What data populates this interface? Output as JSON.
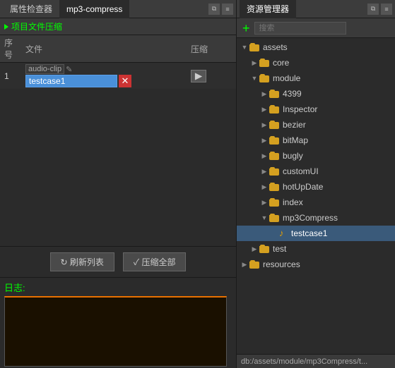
{
  "left_panel": {
    "tabs": [
      {
        "label": "属性检查器",
        "active": false
      },
      {
        "label": "mp3-compress",
        "active": true
      }
    ],
    "section_title": "项目文件压缩",
    "table": {
      "col_num": "序号",
      "col_file": "文件",
      "col_compress": "压缩",
      "rows": [
        {
          "num": "1",
          "file_label": "audio-clip",
          "file_value": "testcase1",
          "has_delete": true,
          "has_play": true
        }
      ]
    },
    "buttons": {
      "refresh": "↻ 刷新列表",
      "compress": "✓ 压缩全部"
    },
    "log": {
      "label": "日志:"
    }
  },
  "right_panel": {
    "tab_label": "资源管理器",
    "add_button": "+",
    "search_placeholder": "搜索",
    "tree": [
      {
        "level": 0,
        "label": "assets",
        "type": "folder",
        "expanded": true
      },
      {
        "level": 1,
        "label": "core",
        "type": "folder",
        "expanded": false
      },
      {
        "level": 1,
        "label": "module",
        "type": "folder",
        "expanded": true
      },
      {
        "level": 2,
        "label": "4399",
        "type": "folder",
        "expanded": false
      },
      {
        "level": 2,
        "label": "Inspector",
        "type": "folder",
        "expanded": false
      },
      {
        "level": 2,
        "label": "bezier",
        "type": "folder",
        "expanded": false
      },
      {
        "level": 2,
        "label": "bitMap",
        "type": "folder",
        "expanded": false
      },
      {
        "level": 2,
        "label": "bugly",
        "type": "folder",
        "expanded": false
      },
      {
        "level": 2,
        "label": "customUI",
        "type": "folder",
        "expanded": false
      },
      {
        "level": 2,
        "label": "hotUpDate",
        "type": "folder",
        "expanded": false
      },
      {
        "level": 2,
        "label": "index",
        "type": "folder",
        "expanded": false
      },
      {
        "level": 2,
        "label": "mp3Compress",
        "type": "folder",
        "expanded": true
      },
      {
        "level": 3,
        "label": "testcase1",
        "type": "audio",
        "selected": true
      },
      {
        "level": 1,
        "label": "test",
        "type": "folder",
        "expanded": false
      },
      {
        "level": 0,
        "label": "resources",
        "type": "folder",
        "expanded": false
      }
    ],
    "status_bar": "db:/assets/module/mp3Compress/t..."
  }
}
